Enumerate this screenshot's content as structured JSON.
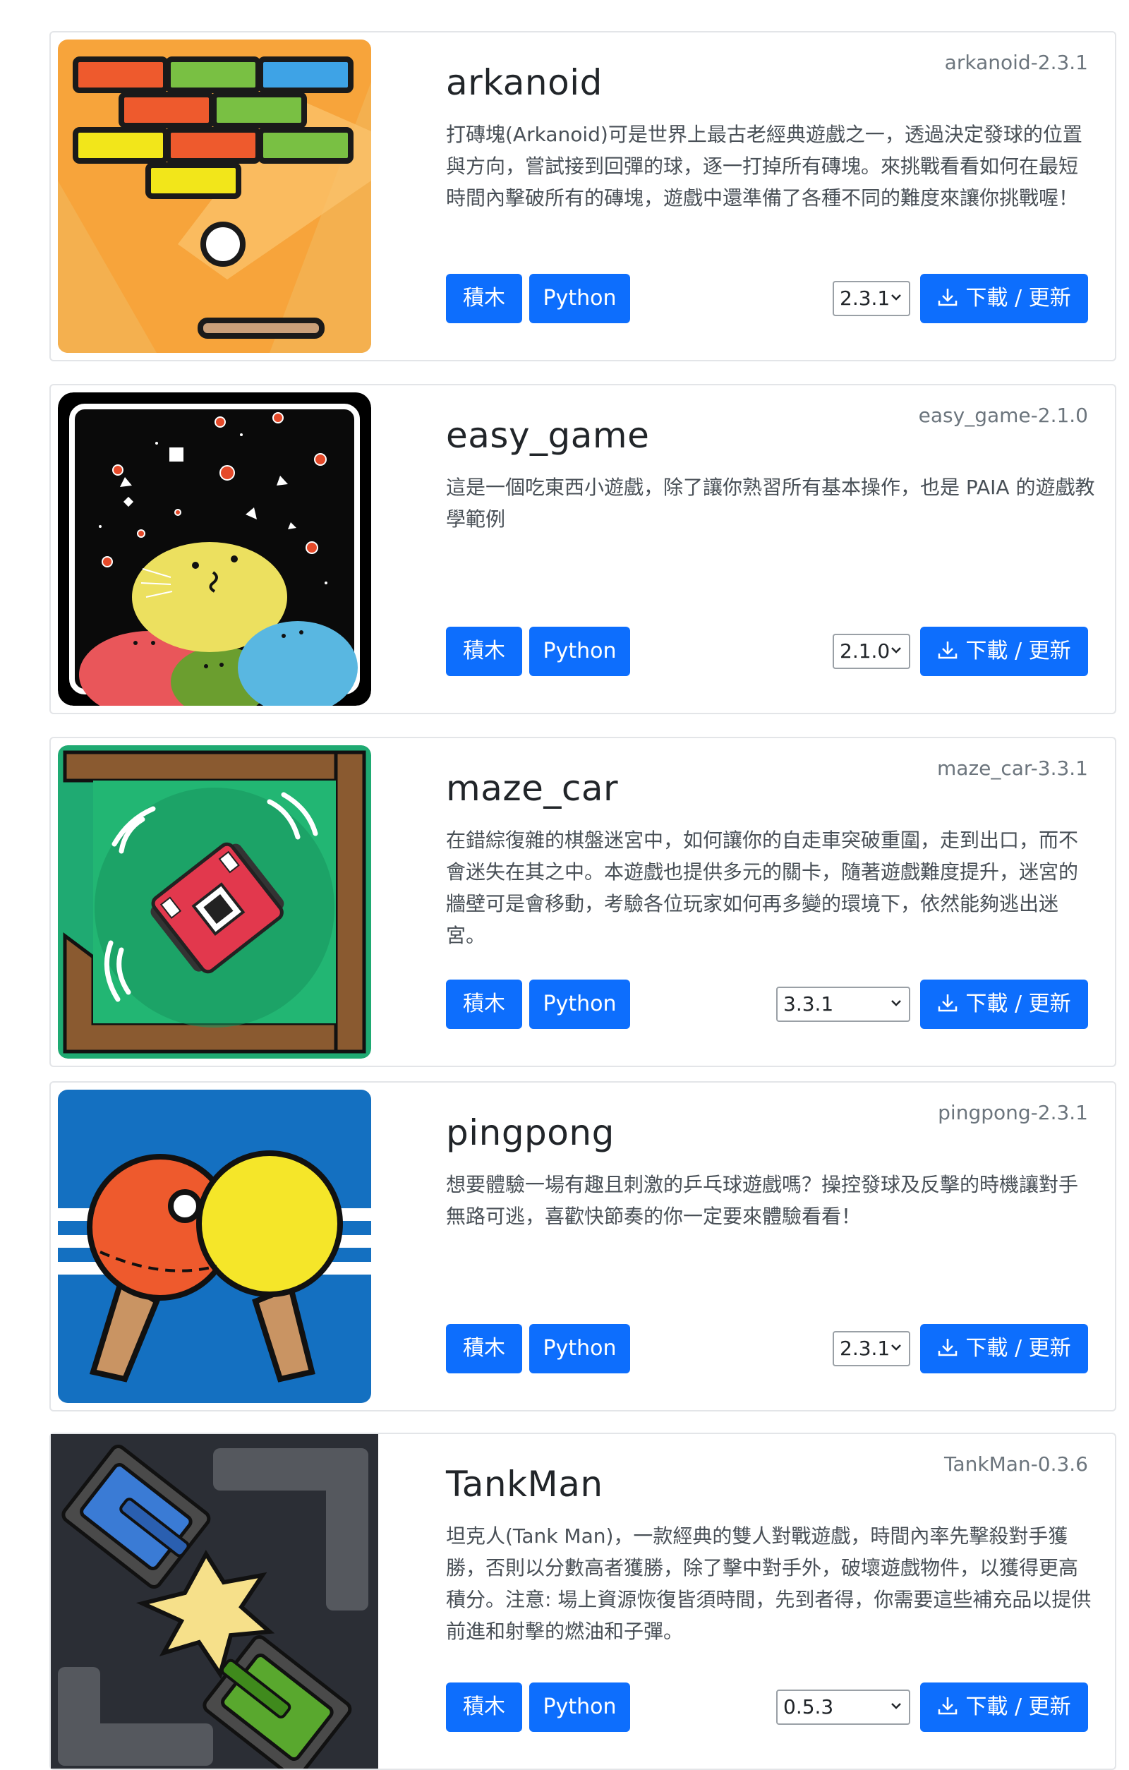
{
  "games": [
    {
      "id": "arkanoid",
      "title": "arkanoid",
      "version_tag": "arkanoid-2.3.1",
      "description": "打磚塊(Arkanoid)可是世界上最古老經典遊戲之一，透過決定發球的位置與方向，嘗試接到回彈的球，逐一打掉所有磚塊。來挑戰看看如何在最短時間內擊破所有的磚塊，遊戲中還準備了各種不同的難度來讓你挑戰喔！",
      "blocks_label": "積木",
      "python_label": "Python",
      "selected_version": "2.3.1",
      "download_label": "下載 / 更新",
      "thumbnail_icon": "arkanoid-thumbnail"
    },
    {
      "id": "easy_game",
      "title": "easy_game",
      "version_tag": "easy_game-2.1.0",
      "description": "這是一個吃東西小遊戲，除了讓你熟習所有基本操作，也是 PAIA 的遊戲教學範例",
      "blocks_label": "積木",
      "python_label": "Python",
      "selected_version": "2.1.0",
      "download_label": "下載 / 更新",
      "thumbnail_icon": "easy-game-thumbnail"
    },
    {
      "id": "maze_car",
      "title": "maze_car",
      "version_tag": "maze_car-3.3.1",
      "description": "在錯綜復雜的棋盤迷宮中，如何讓你的自走車突破重圍，走到出口，而不會迷失在其之中。本遊戲也提供多元的關卡，隨著遊戲難度提升，迷宮的牆壁可是會移動，考驗各位玩家如何再多變的環境下，依然能夠逃出迷宮。",
      "blocks_label": "積木",
      "python_label": "Python",
      "selected_version": "3.3.1",
      "download_label": "下載 / 更新",
      "thumbnail_icon": "maze-car-thumbnail"
    },
    {
      "id": "pingpong",
      "title": "pingpong",
      "version_tag": "pingpong-2.3.1",
      "description": "想要體驗一場有趣且刺激的乒乓球遊戲嗎？操控發球及反擊的時機讓對手無路可逃，喜歡快節奏的你一定要來體驗看看！",
      "blocks_label": "積木",
      "python_label": "Python",
      "selected_version": "2.3.1",
      "download_label": "下載 / 更新",
      "thumbnail_icon": "pingpong-thumbnail"
    },
    {
      "id": "tankman",
      "title": "TankMan",
      "version_tag": "TankMan-0.3.6",
      "description": "坦克人(Tank Man)，一款經典的雙人對戰遊戲，時間內率先擊殺對手獲勝，否則以分數高者獲勝，除了擊中對手外，破壞遊戲物件，以獲得更高積分。注意: 場上資源恢復皆須時間，先到者得，你需要這些補充品以提供前進和射擊的燃油和子彈。",
      "blocks_label": "積木",
      "python_label": "Python",
      "selected_version": "0.5.3",
      "download_label": "下載 / 更新",
      "thumbnail_icon": "tankman-thumbnail"
    }
  ],
  "colors": {
    "primary": "#0d6efd",
    "muted": "#6c757d",
    "border": "#e3e5e8"
  },
  "icons": {
    "download": "download-icon",
    "select": "chevron-down-icon"
  }
}
